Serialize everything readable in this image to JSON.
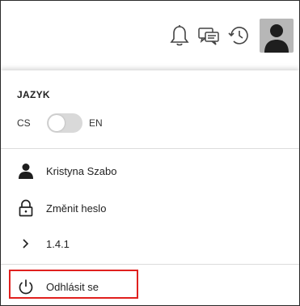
{
  "topbar": {
    "icons": [
      "bell-icon",
      "chat-icon",
      "history-icon",
      "user-avatar-icon"
    ]
  },
  "panel": {
    "language_title": "JAZYK",
    "lang_cs": "CS",
    "lang_en": "EN",
    "toggle_state": "CS",
    "user_name": "Kristyna Szabo",
    "change_password": "Změnit heslo",
    "version": "1.4.1",
    "logout": "Odhlásit se"
  },
  "colors": {
    "highlight": "#e0201e",
    "avatar_bg": "#b7b7b7",
    "toggle_track": "#d9d9d9"
  }
}
